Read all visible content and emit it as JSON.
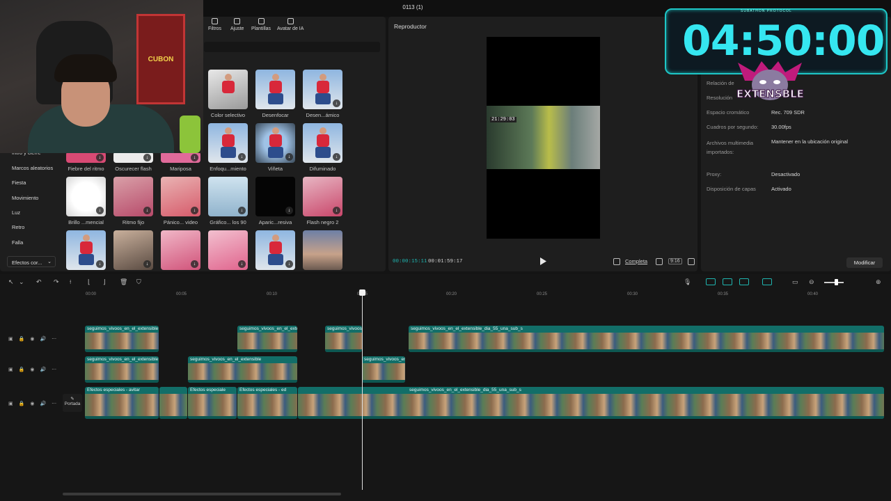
{
  "window": {
    "title": "0113 (1)"
  },
  "media": {
    "tabs": [
      {
        "label": "Filtros"
      },
      {
        "label": "Ajuste"
      },
      {
        "label": "Plantillas"
      },
      {
        "label": "Avatar de IA"
      }
    ],
    "categories": [
      "Intro y cierre",
      "Marcos aleatorios",
      "Fiesta",
      "Movimiento",
      "Luz",
      "Retro",
      "Falla"
    ],
    "dropdown_label": "Efectos cor...",
    "row1": [
      "Color selectivo",
      "Desenfocar",
      "Desen...ámico"
    ],
    "row2": [
      "Enfoqu...miento",
      "Viñeta",
      "Difuminado"
    ],
    "row3": [
      "Fiebre del ritmo",
      "Oscurecer flash",
      "Mariposa"
    ],
    "row4": [
      "Brillo ...mencial",
      "Ritmo fijo",
      "Pánico... video",
      "Gráfico... los 90",
      "Aparic...resiva",
      "Flash negro 2"
    ]
  },
  "webcam": {
    "cabinet_text": "CUBON"
  },
  "player": {
    "title": "Reproductor",
    "video_timer": "21:29:03",
    "time_current": "00:00:15:11",
    "time_total": "00:01:59:17",
    "completa_label": "Completa",
    "ratio_label": "9:16"
  },
  "properties": {
    "rows": [
      {
        "label": "Relación de",
        "value": ""
      },
      {
        "label": "Resolución",
        "value": ""
      },
      {
        "label": "Espacio cromático",
        "value": "Rec. 709 SDR"
      },
      {
        "label": "Cuadros por segundo:",
        "value": "30.00fps"
      },
      {
        "label": "Archivos multimedia importados:",
        "value": "Mantener en la ubicación original"
      },
      {
        "label": "Proxy:",
        "value": "Desactivado"
      },
      {
        "label": "Disposición de capas",
        "value": "Activado"
      }
    ],
    "modify_label": "Modificar"
  },
  "overlay": {
    "timer_caption": "SUBATHON PROTOCOL",
    "timer": "04:50:00",
    "logo_text": "EXTENSBLE"
  },
  "timeline": {
    "ruler": [
      "00:00",
      "00:05",
      "00:10",
      "00:15",
      "00:20",
      "00:25",
      "00:30",
      "00:35",
      "00:40"
    ],
    "cover_label": "Portada",
    "clip_name": "seguimos_vivoos_en_el_extensible",
    "clip_name_long": "seguimos_vivoos_en_el_extensible_dia_55_una_sub_s",
    "effect_name": "Efectos especiales - avitar",
    "effect_name_short": "Efectos especiale",
    "effect_name_2": "Efectos especiales - ed"
  },
  "colors": {
    "accent": "#1fb5b0",
    "clip": "#126e68",
    "timer": "#35e6f0"
  }
}
